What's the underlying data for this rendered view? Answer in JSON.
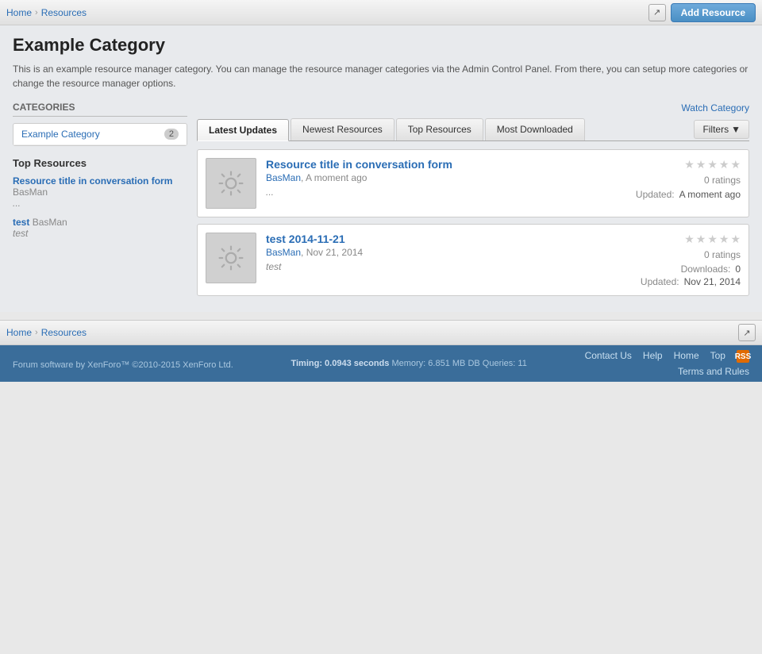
{
  "topNav": {
    "breadcrumbs": [
      {
        "label": "Home",
        "id": "home"
      },
      {
        "label": "Resources",
        "id": "resources"
      }
    ],
    "addResourceLabel": "Add Resource"
  },
  "page": {
    "title": "Example Category",
    "description": "This is an example resource manager category. You can manage the resource manager categories via the Admin Control Panel. From there, you can setup more categories or change the resource manager options."
  },
  "sidebar": {
    "categoriesTitle": "Categories",
    "categories": [
      {
        "label": "Example Category",
        "count": "2"
      }
    ],
    "topResourcesTitle": "Top Resources",
    "topResources": [
      {
        "title": "Resource title in conversation form",
        "author": "BasMan",
        "excerpt": "..."
      },
      {
        "title": "test",
        "author": "BasMan",
        "excerpt": "test"
      }
    ]
  },
  "watchCategory": "Watch Category",
  "tabs": [
    {
      "label": "Latest Updates",
      "active": true
    },
    {
      "label": "Newest Resources",
      "active": false
    },
    {
      "label": "Top Resources",
      "active": false
    },
    {
      "label": "Most Downloaded",
      "active": false
    }
  ],
  "filtersLabel": "Filters",
  "resources": [
    {
      "title": "Resource title in conversation form",
      "author": "BasMan",
      "date": "A moment ago",
      "ratings": "0 ratings",
      "updatedLabel": "Updated:",
      "updatedValue": "A moment ago",
      "excerpt": "...",
      "stars": [
        false,
        false,
        false,
        false,
        false
      ]
    },
    {
      "title": "test 2014-11-21",
      "author": "BasMan",
      "date": "Nov 21, 2014",
      "ratings": "0 ratings",
      "downloadsLabel": "Downloads:",
      "downloadsValue": "0",
      "updatedLabel": "Updated:",
      "updatedValue": "Nov 21, 2014",
      "excerpt": "test",
      "stars": [
        false,
        false,
        false,
        false,
        false
      ]
    }
  ],
  "bottomBreadcrumbs": [
    {
      "label": "Home"
    },
    {
      "label": "Resources"
    }
  ],
  "footer": {
    "links": [
      {
        "label": "Contact Us"
      },
      {
        "label": "Help"
      },
      {
        "label": "Home"
      },
      {
        "label": "Top"
      }
    ],
    "copyright": "Forum software by XenForo™ ©2010-2015 XenForo Ltd.",
    "timing": "Timing: 0.0943 seconds",
    "memory": "Memory: 6.851 MB",
    "dbQueries": "DB Queries: 11",
    "termsLabel": "Terms and Rules"
  }
}
